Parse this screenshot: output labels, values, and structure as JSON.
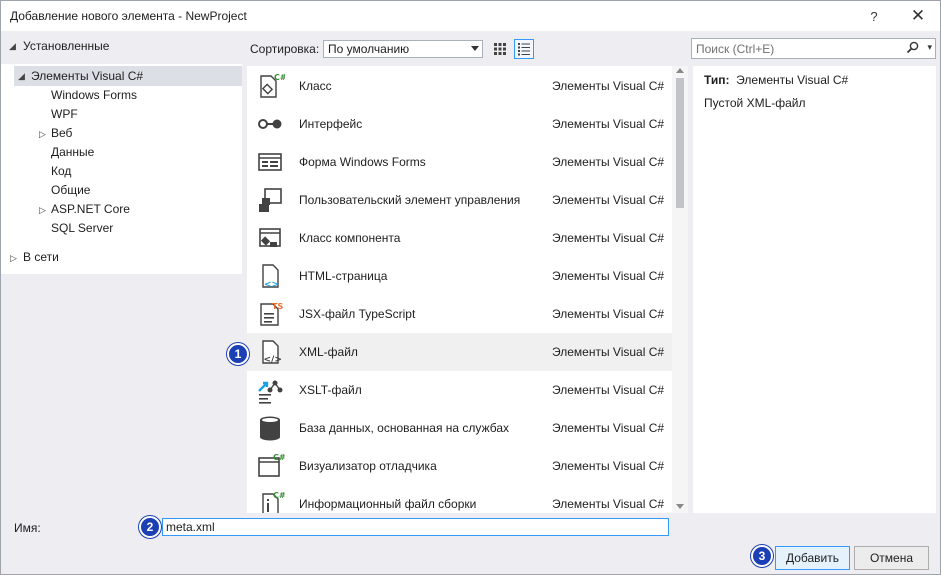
{
  "window": {
    "title": "Добавление нового элемента  - NewProject",
    "help_label": "?",
    "close_label": "✕"
  },
  "tree": {
    "installed_label": "Установленные",
    "root_label": "Элементы Visual C#",
    "children": [
      {
        "label": "Windows Forms",
        "expandable": false
      },
      {
        "label": "WPF",
        "expandable": false
      },
      {
        "label": "Веб",
        "expandable": true
      },
      {
        "label": "Данные",
        "expandable": false
      },
      {
        "label": "Код",
        "expandable": false
      },
      {
        "label": "Общие",
        "expandable": false
      },
      {
        "label": "ASP.NET Core",
        "expandable": true
      },
      {
        "label": "SQL Server",
        "expandable": false
      }
    ],
    "online_label": "В сети"
  },
  "toolbar": {
    "sort_label": "Сортировка:",
    "sort_value": "По умолчанию",
    "search_placeholder": "Поиск (Ctrl+E)"
  },
  "items": [
    {
      "name": "Класс",
      "category": "Элементы Visual C#",
      "icon": "class-icon"
    },
    {
      "name": "Интерфейс",
      "category": "Элементы Visual C#",
      "icon": "interface-icon"
    },
    {
      "name": "Форма Windows Forms",
      "category": "Элементы Visual C#",
      "icon": "windows-form-icon"
    },
    {
      "name": "Пользовательский элемент управления",
      "category": "Элементы Visual C#",
      "icon": "user-control-icon"
    },
    {
      "name": "Класс компонента",
      "category": "Элементы Visual C#",
      "icon": "component-class-icon"
    },
    {
      "name": "HTML-страница",
      "category": "Элементы Visual C#",
      "icon": "html-page-icon"
    },
    {
      "name": "JSX-файл TypeScript",
      "category": "Элементы Visual C#",
      "icon": "typescript-jsx-icon"
    },
    {
      "name": "XML-файл",
      "category": "Элементы Visual C#",
      "icon": "xml-file-icon"
    },
    {
      "name": "XSLT-файл",
      "category": "Элементы Visual C#",
      "icon": "xslt-file-icon"
    },
    {
      "name": "База данных, основанная на службах",
      "category": "Элементы Visual C#",
      "icon": "database-icon"
    },
    {
      "name": "Визуализатор отладчика",
      "category": "Элементы Visual C#",
      "icon": "debugger-visualizer-icon"
    },
    {
      "name": "Информационный файл сборки",
      "category": "Элементы Visual C#",
      "icon": "assembly-info-icon"
    }
  ],
  "details": {
    "type_label": "Тип:",
    "type_value": "Элементы Visual C#",
    "description": "Пустой XML-файл"
  },
  "bottom": {
    "name_label": "Имя:",
    "name_value": "meta.xml",
    "add_label": "Добавить",
    "cancel_label": "Отмена"
  },
  "markers": [
    "1",
    "2",
    "3"
  ],
  "colors": {
    "accent": "#3399ff",
    "marker": "#1b3fb4",
    "selected_tree": "#dcdfe6",
    "hover_row": "#f0f0f0",
    "csharp_green": "#388a34",
    "icon_dark": "#424242",
    "icon_blue": "#1ba1e2",
    "ts_orange": "#e8702a"
  }
}
